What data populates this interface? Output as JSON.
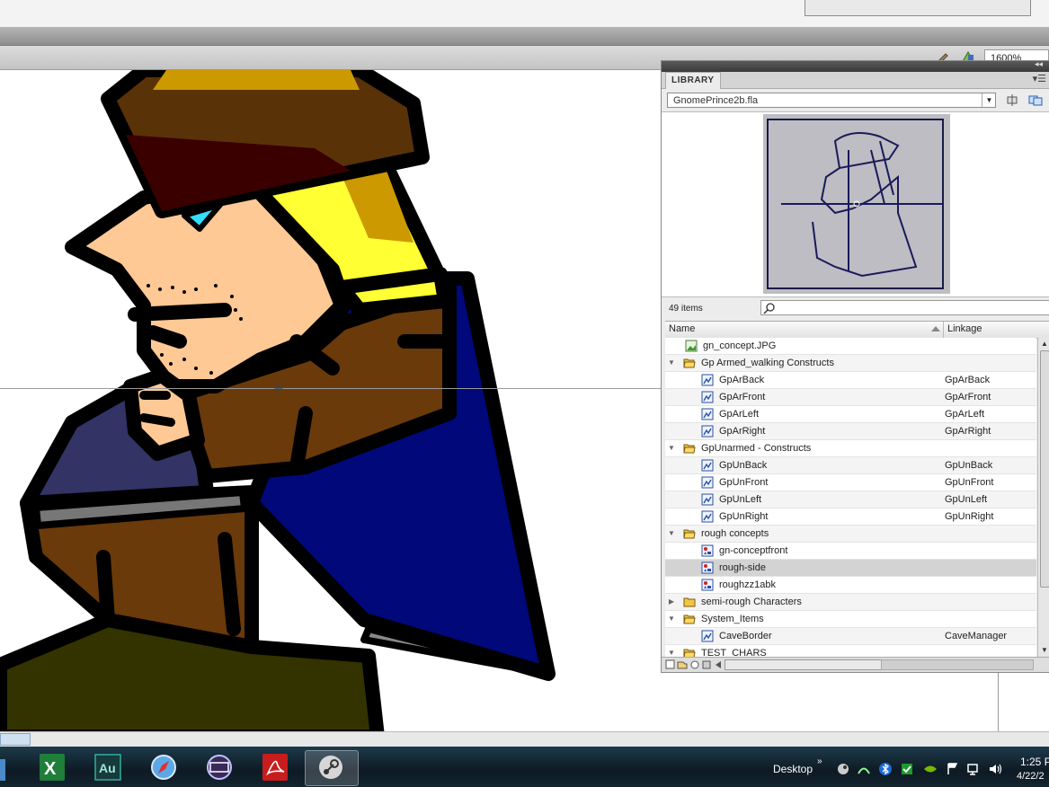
{
  "toolbar": {
    "zoom": "1600%"
  },
  "library": {
    "tab_label": "LIBRARY",
    "menu_icon": "panel-menu-icon",
    "file": "GnomePrince2b.fla",
    "item_count": "49 items",
    "search_placeholder": "",
    "columns": {
      "name": "Name",
      "linkage": "Linkage"
    },
    "rows": [
      {
        "name": "gn_concept.JPG",
        "linkage": "",
        "type": "bitmap",
        "indent": 1,
        "twisty": ""
      },
      {
        "name": "Gp Armed_walking Constructs",
        "linkage": "",
        "type": "folder-open",
        "indent": 0,
        "twisty": "▼"
      },
      {
        "name": "GpArBack",
        "linkage": "GpArBack",
        "type": "movieclip",
        "indent": 2,
        "twisty": ""
      },
      {
        "name": "GpArFront",
        "linkage": "GpArFront",
        "type": "movieclip",
        "indent": 2,
        "twisty": ""
      },
      {
        "name": "GpArLeft",
        "linkage": "GpArLeft",
        "type": "movieclip",
        "indent": 2,
        "twisty": ""
      },
      {
        "name": "GpArRight",
        "linkage": "GpArRight",
        "type": "movieclip",
        "indent": 2,
        "twisty": ""
      },
      {
        "name": "GpUnarmed - Constructs",
        "linkage": "",
        "type": "folder-open",
        "indent": 0,
        "twisty": "▼"
      },
      {
        "name": "GpUnBack",
        "linkage": "GpUnBack",
        "type": "movieclip",
        "indent": 2,
        "twisty": ""
      },
      {
        "name": "GpUnFront",
        "linkage": "GpUnFront",
        "type": "movieclip",
        "indent": 2,
        "twisty": ""
      },
      {
        "name": "GpUnLeft",
        "linkage": "GpUnLeft",
        "type": "movieclip",
        "indent": 2,
        "twisty": ""
      },
      {
        "name": "GpUnRight",
        "linkage": "GpUnRight",
        "type": "movieclip",
        "indent": 2,
        "twisty": ""
      },
      {
        "name": "rough concepts",
        "linkage": "",
        "type": "folder-open",
        "indent": 0,
        "twisty": "▼"
      },
      {
        "name": "gn-conceptfront",
        "linkage": "",
        "type": "graphic",
        "indent": 2,
        "twisty": ""
      },
      {
        "name": "rough-side",
        "linkage": "",
        "type": "graphic",
        "indent": 2,
        "twisty": "",
        "selected": true
      },
      {
        "name": "roughzz1abk",
        "linkage": "",
        "type": "graphic",
        "indent": 2,
        "twisty": ""
      },
      {
        "name": "semi-rough Characters",
        "linkage": "",
        "type": "folder-closed",
        "indent": 0,
        "twisty": "▶"
      },
      {
        "name": "System_Items",
        "linkage": "",
        "type": "folder-open",
        "indent": 0,
        "twisty": "▼"
      },
      {
        "name": "CaveBorder",
        "linkage": "CaveManager",
        "type": "movieclip",
        "indent": 2,
        "twisty": ""
      },
      {
        "name": "TEST_CHARS",
        "linkage": "",
        "type": "folder-open",
        "indent": 0,
        "twisty": "▼"
      }
    ]
  },
  "taskbar": {
    "apps": [
      "excel-icon",
      "audition-icon",
      "safari-icon",
      "media-icon",
      "acrobat-icon",
      "steam-icon"
    ],
    "desktop_label": "Desktop",
    "desktop_chevron": "»",
    "time": "1:25 P",
    "date": "4/22/2"
  },
  "colors": {
    "hat": "#5a3208",
    "hat_dark": "#3a0000",
    "hair": "#ffff33",
    "hair_shade": "#cc9900",
    "skin": "#ffc995",
    "cape": "#00087a",
    "coat": "#6b3a0a",
    "pants": "#333300",
    "sleeve": "#333366"
  }
}
